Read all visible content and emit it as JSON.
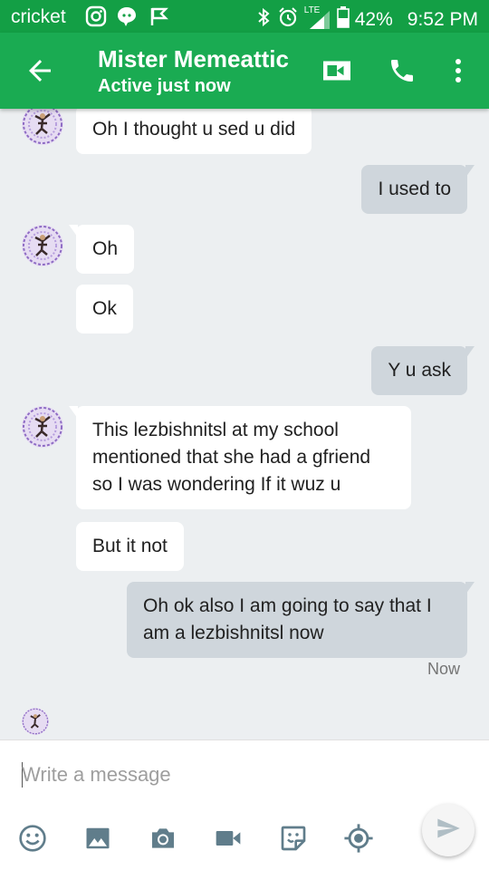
{
  "status_bar": {
    "carrier": "cricket",
    "network": "LTE",
    "battery": "42%",
    "time": "9:52 PM"
  },
  "header": {
    "contact_name": "Mister Memeattic",
    "status": "Active just now"
  },
  "messages": [
    {
      "direction": "incoming",
      "text": "Oh I thought u sed u did"
    },
    {
      "direction": "outgoing",
      "text": "I used to"
    },
    {
      "direction": "incoming",
      "text": "Oh"
    },
    {
      "direction": "incoming",
      "text": "Ok"
    },
    {
      "direction": "outgoing",
      "text": "Y u ask"
    },
    {
      "direction": "incoming",
      "text": "This lezbishnitsl at my school mentioned that she had a gfriend so I was wondering If it wuz u"
    },
    {
      "direction": "incoming",
      "text": "But it not"
    },
    {
      "direction": "outgoing",
      "text": "Oh ok also I am going to say that I am a lezbishnitsl now"
    }
  ],
  "last_timestamp": "Now",
  "composer": {
    "placeholder": "Write a message"
  },
  "colors": {
    "status_bar": "#139f45",
    "app_bar": "#1aab52",
    "chat_background": "#eceff1",
    "incoming_bubble": "#ffffff",
    "outgoing_bubble": "#cfd6dc",
    "icon_gray": "#607d8b"
  },
  "icons": {
    "status_left": [
      "instagram-icon",
      "chat-bubble-icon",
      "flag-icon"
    ],
    "status_right": [
      "bluetooth-icon",
      "alarm-icon",
      "signal-icon",
      "battery-icon"
    ],
    "app_bar": [
      "back-arrow-icon",
      "video-call-icon",
      "phone-icon",
      "more-vert-icon"
    ],
    "composer_tools": [
      "emoji-icon",
      "gallery-icon",
      "camera-icon",
      "video-icon",
      "sticker-icon",
      "location-icon",
      "send-icon"
    ]
  }
}
